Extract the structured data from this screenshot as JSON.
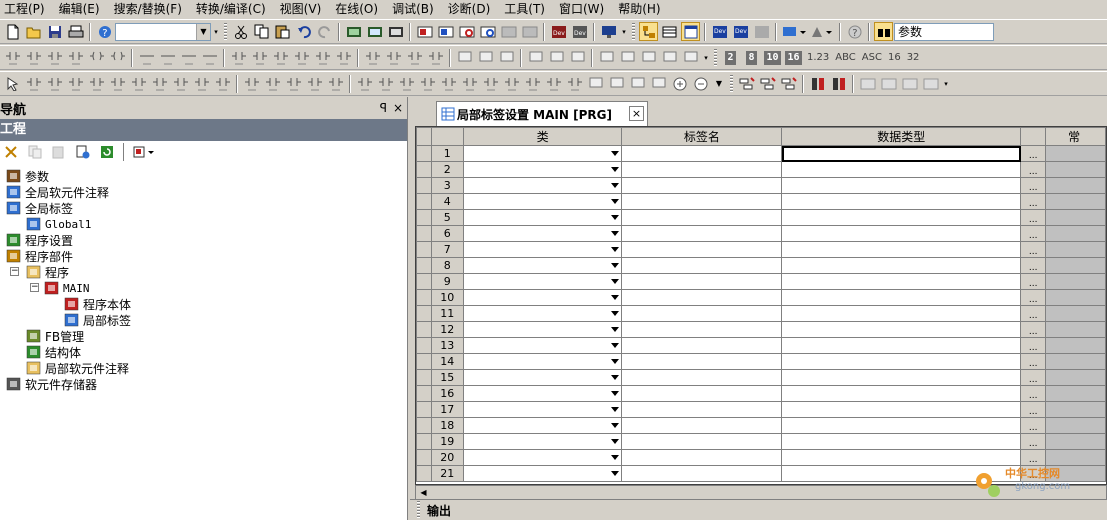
{
  "menu": [
    "工程(P)",
    "编辑(E)",
    "搜索/替换(F)",
    "转换/编译(C)",
    "视图(V)",
    "在线(O)",
    "调试(B)",
    "诊断(D)",
    "工具(T)",
    "窗口(W)",
    "帮助(H)"
  ],
  "toolbar": {
    "dropdown_text": "参数",
    "number_glyphs": [
      "2",
      "8",
      "10",
      "16"
    ],
    "format_labels": [
      "1.23",
      "ABC",
      "ASC",
      "16",
      "32"
    ]
  },
  "nav": {
    "title": "导航",
    "pin": "ꟼ",
    "close": "×",
    "project_header": "工程",
    "tree": [
      {
        "label": "参数",
        "icon": "parameter-icon"
      },
      {
        "label": "全局软元件注释",
        "icon": "global-device-comment-icon"
      },
      {
        "label": "全局标签",
        "icon": "global-label-icon"
      },
      {
        "label": "Global1",
        "icon": "label-table-icon"
      },
      {
        "label": "程序设置",
        "icon": "program-setting-icon"
      },
      {
        "label": "程序部件",
        "icon": "program-parts-icon"
      },
      {
        "label": "程序",
        "icon": "folder-icon"
      },
      {
        "label": "MAIN",
        "icon": "program-main-icon"
      },
      {
        "label": "程序本体",
        "icon": "program-body-icon"
      },
      {
        "label": "局部标签",
        "icon": "local-label-icon"
      },
      {
        "label": "FB管理",
        "icon": "fb-folder-icon"
      },
      {
        "label": "结构体",
        "icon": "structure-icon"
      },
      {
        "label": "局部软元件注释",
        "icon": "local-comment-icon"
      },
      {
        "label": "软元件存储器",
        "icon": "device-memory-icon"
      }
    ]
  },
  "doc": {
    "tab_label": "局部标签设置 MAIN [PRG]",
    "close": "×",
    "columns": [
      "类",
      "标签名",
      "数据类型",
      "常"
    ],
    "rows": [
      "1",
      "2",
      "3",
      "4",
      "5",
      "6",
      "7",
      "8",
      "9",
      "10",
      "11",
      "12",
      "13",
      "14",
      "15",
      "16",
      "17",
      "18",
      "19",
      "20",
      "21"
    ],
    "ellipsis": "..."
  },
  "output": {
    "label": "输出"
  },
  "watermark": {
    "text": "中华工控网",
    "sub": "gkong.com"
  },
  "colors": {
    "project_header": "#6d7888",
    "panel": "#d4d0c8",
    "grid_line": "#808080"
  }
}
